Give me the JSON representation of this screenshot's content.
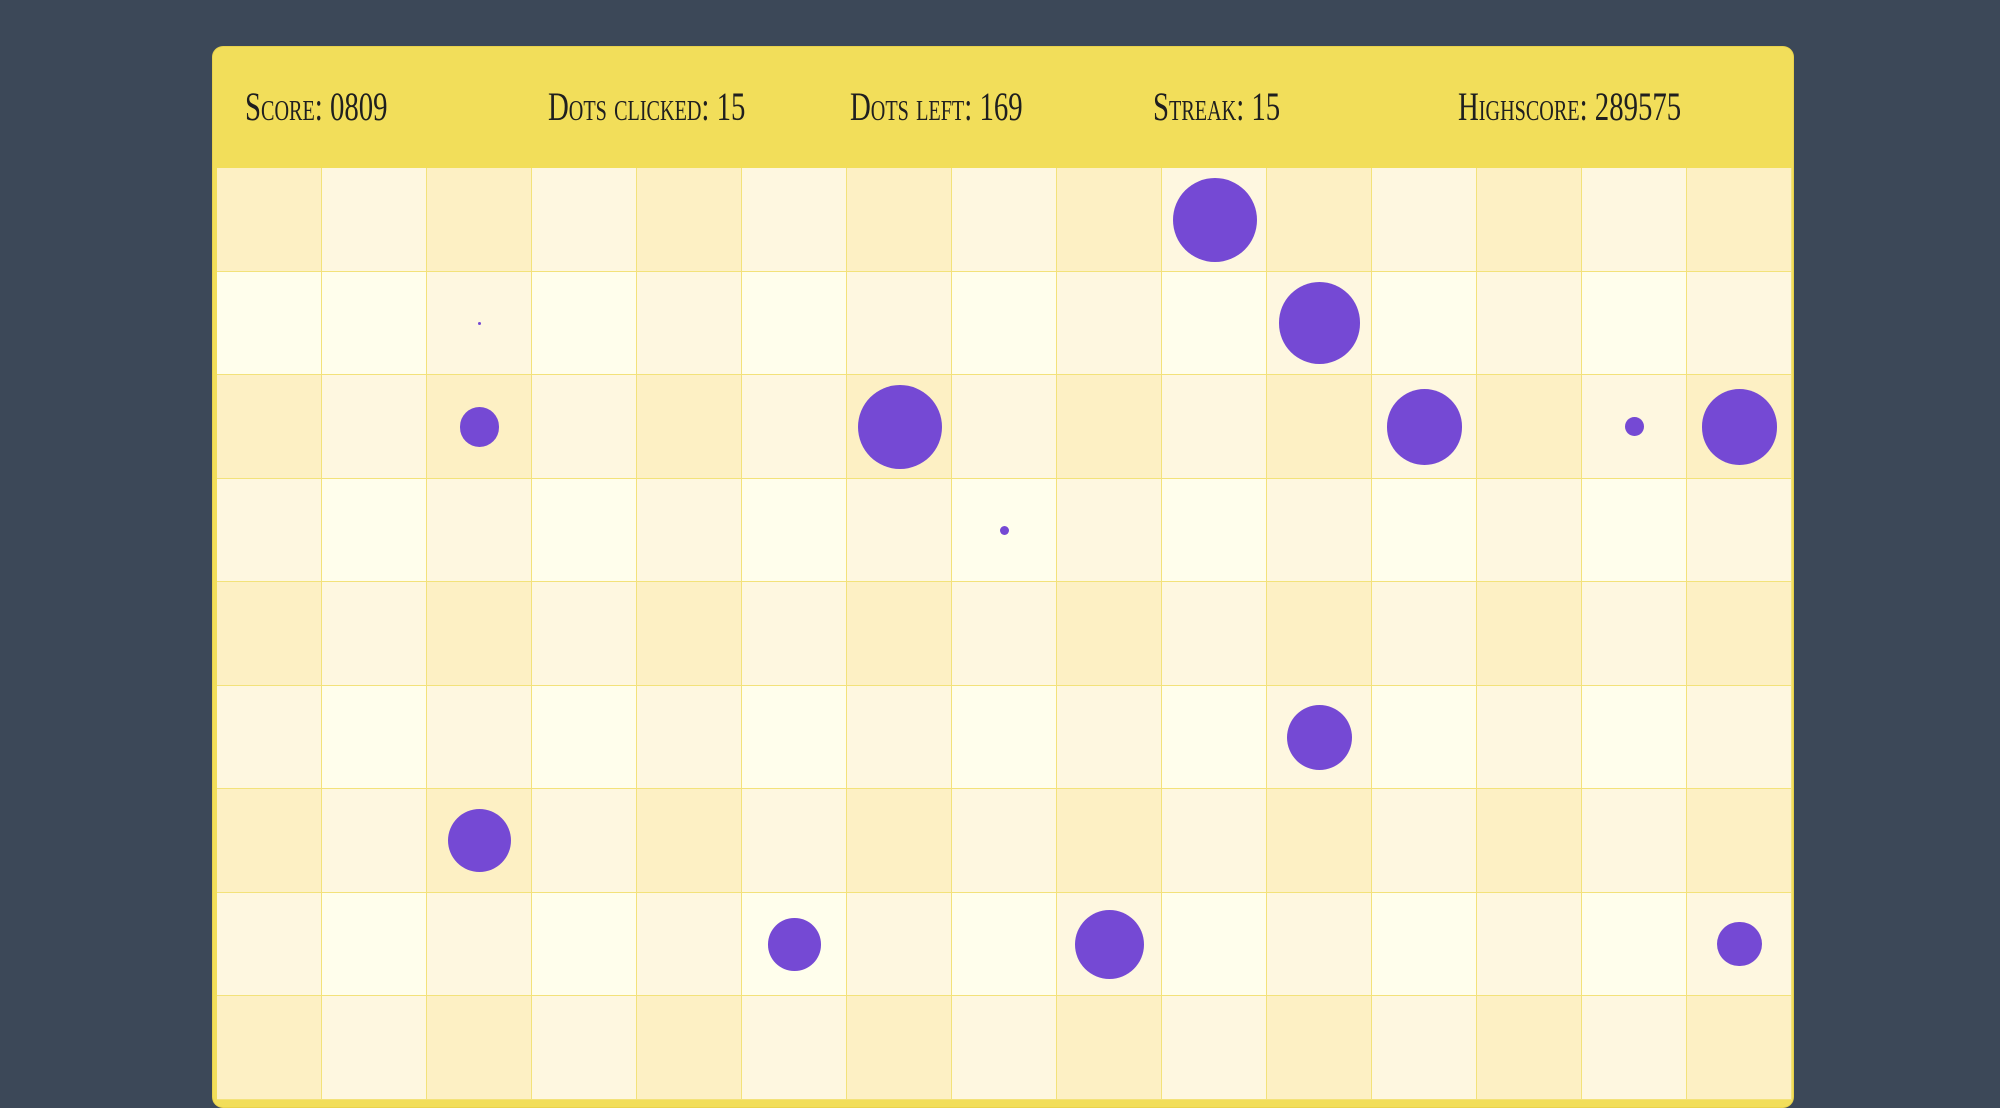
{
  "stats": {
    "score": "Score: 0809",
    "dots_clicked": "Dots clicked: 15",
    "dots_left": "Dots left: 169",
    "streak": "Streak: 15",
    "highscore": "Highscore: 289575"
  },
  "colors": {
    "page_background": "#3c4858",
    "panel": "#f2de5a",
    "grid_line": "#f3e27a",
    "dot": "#7549d4",
    "cell_dark": "#fdf0c4",
    "cell_mid": "#fef7e0",
    "cell_light": "#fffeec"
  },
  "board": {
    "columns": 15,
    "rows_visible": 9,
    "row_shading": [
      [
        "dark",
        "mid",
        "dark",
        "mid",
        "dark",
        "mid",
        "dark",
        "mid",
        "dark",
        "mid",
        "dark",
        "mid",
        "dark",
        "mid",
        "dark"
      ],
      [
        "light",
        "light",
        "mid",
        "light",
        "mid",
        "light",
        "mid",
        "light",
        "mid",
        "light",
        "mid",
        "light",
        "mid",
        "light",
        "mid"
      ],
      [
        "dark",
        "mid",
        "dark",
        "mid",
        "dark",
        "mid",
        "dark",
        "mid",
        "dark",
        "mid",
        "dark",
        "mid",
        "dark",
        "mid",
        "dark"
      ],
      [
        "mid",
        "light",
        "mid",
        "light",
        "mid",
        "light",
        "mid",
        "light",
        "mid",
        "light",
        "mid",
        "light",
        "mid",
        "light",
        "mid"
      ],
      [
        "dark",
        "mid",
        "dark",
        "mid",
        "dark",
        "mid",
        "dark",
        "mid",
        "dark",
        "mid",
        "dark",
        "mid",
        "dark",
        "mid",
        "dark"
      ],
      [
        "mid",
        "light",
        "mid",
        "light",
        "mid",
        "light",
        "mid",
        "light",
        "mid",
        "light",
        "mid",
        "light",
        "mid",
        "light",
        "mid"
      ],
      [
        "dark",
        "mid",
        "dark",
        "mid",
        "dark",
        "mid",
        "dark",
        "mid",
        "dark",
        "mid",
        "dark",
        "mid",
        "dark",
        "mid",
        "dark"
      ],
      [
        "mid",
        "light",
        "mid",
        "light",
        "mid",
        "light",
        "mid",
        "light",
        "mid",
        "light",
        "mid",
        "light",
        "mid",
        "light",
        "mid"
      ],
      [
        "dark",
        "mid",
        "dark",
        "mid",
        "dark",
        "mid",
        "dark",
        "mid",
        "dark",
        "mid",
        "dark",
        "mid",
        "dark",
        "mid",
        "dark"
      ]
    ],
    "dots": [
      {
        "row": 0,
        "col": 9,
        "size": 0.8
      },
      {
        "row": 1,
        "col": 2,
        "size": 0.03
      },
      {
        "row": 1,
        "col": 10,
        "size": 0.78
      },
      {
        "row": 2,
        "col": 2,
        "size": 0.38
      },
      {
        "row": 2,
        "col": 6,
        "size": 0.8
      },
      {
        "row": 2,
        "col": 11,
        "size": 0.72
      },
      {
        "row": 2,
        "col": 13,
        "size": 0.18
      },
      {
        "row": 2,
        "col": 14,
        "size": 0.72
      },
      {
        "row": 3,
        "col": 7,
        "size": 0.09
      },
      {
        "row": 5,
        "col": 10,
        "size": 0.62
      },
      {
        "row": 6,
        "col": 2,
        "size": 0.6
      },
      {
        "row": 7,
        "col": 5,
        "size": 0.5
      },
      {
        "row": 7,
        "col": 8,
        "size": 0.66
      },
      {
        "row": 7,
        "col": 14,
        "size": 0.42
      }
    ]
  }
}
